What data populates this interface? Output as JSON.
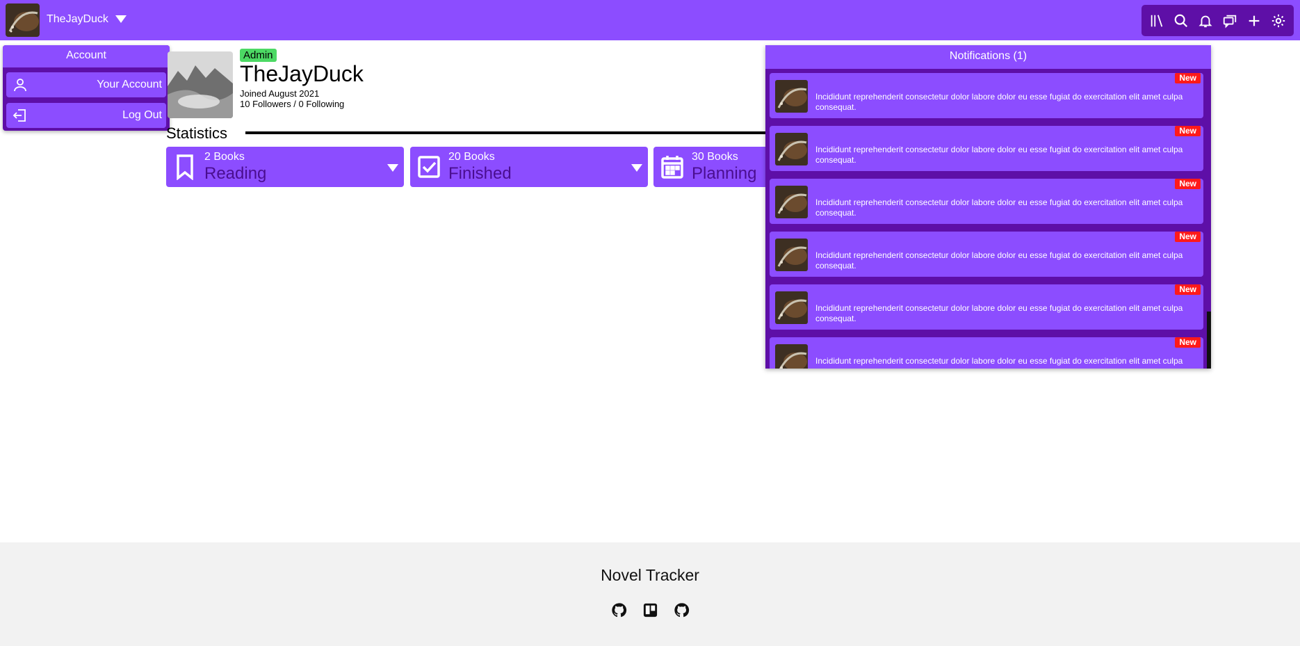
{
  "header": {
    "username": "TheJayDuck",
    "icons": [
      "library-icon",
      "search-icon",
      "bell-icon",
      "chat-icon",
      "plus-icon",
      "settings-icon"
    ]
  },
  "account_menu": {
    "title": "Account",
    "items": [
      {
        "label": "Your Account",
        "icon": "user-icon"
      },
      {
        "label": "Log Out",
        "icon": "logout-icon"
      }
    ]
  },
  "profile": {
    "badge": "Admin",
    "name": "TheJayDuck",
    "joined": "Joined August 2021",
    "follows": "10 Followers / 0 Following"
  },
  "statistics": {
    "heading": "Statistics",
    "cards": [
      {
        "count": "2 Books",
        "label": "Reading",
        "icon": "bookmark-icon"
      },
      {
        "count": "20 Books",
        "label": "Finished",
        "icon": "checkbox-icon"
      },
      {
        "count": "30 Books",
        "label": "Planning",
        "icon": "calendar-icon"
      }
    ]
  },
  "notifications": {
    "title": "Notifications (1)",
    "items": [
      {
        "badge": "New",
        "text": "Incididunt reprehenderit consectetur dolor labore dolor eu esse fugiat do exercitation elit amet culpa consequat."
      },
      {
        "badge": "New",
        "text": "Incididunt reprehenderit consectetur dolor labore dolor eu esse fugiat do exercitation elit amet culpa consequat."
      },
      {
        "badge": "New",
        "text": "Incididunt reprehenderit consectetur dolor labore dolor eu esse fugiat do exercitation elit amet culpa consequat."
      },
      {
        "badge": "New",
        "text": "Incididunt reprehenderit consectetur dolor labore dolor eu esse fugiat do exercitation elit amet culpa consequat."
      },
      {
        "badge": "New",
        "text": "Incididunt reprehenderit consectetur dolor labore dolor eu esse fugiat do exercitation elit amet culpa consequat."
      },
      {
        "badge": "New",
        "text": "Incididunt reprehenderit consectetur dolor labore dolor eu esse fugiat do exercitation elit amet culpa consequat."
      }
    ]
  },
  "footer": {
    "title": "Novel Tracker",
    "icons": [
      "github-icon",
      "trello-icon",
      "github-icon"
    ]
  },
  "colors": {
    "primary": "#8c4dff",
    "dark_primary": "#5e0fa7",
    "admin_badge": "#4cd964",
    "new_badge": "#ff1a1a",
    "footer_bg": "#f2f2f2"
  }
}
